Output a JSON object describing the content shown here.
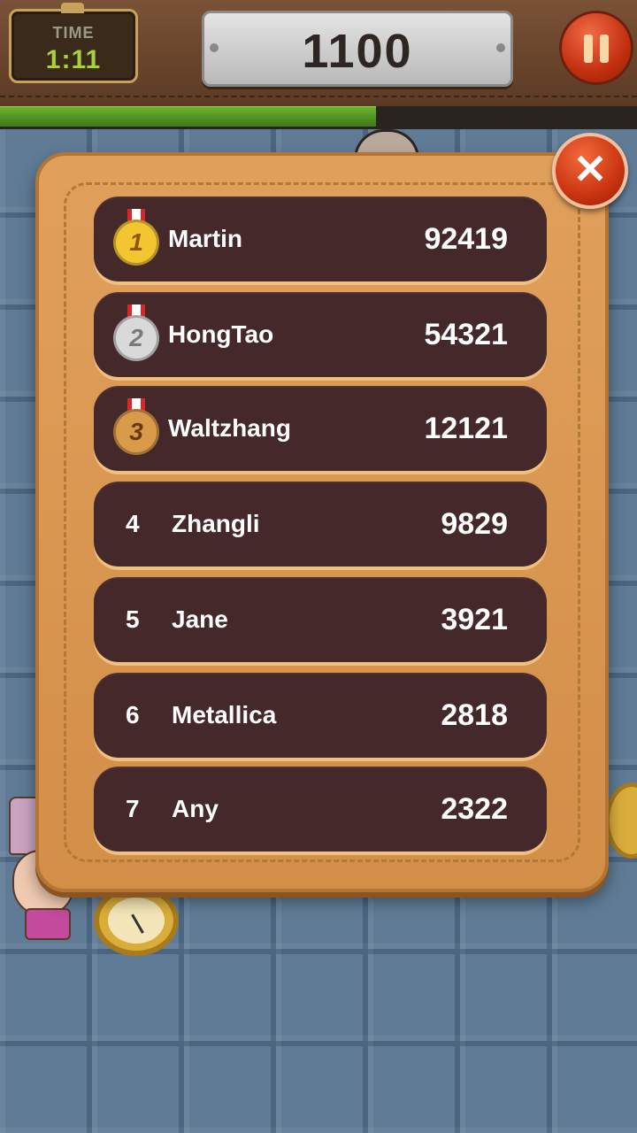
{
  "hud": {
    "time_label": "TIME",
    "time_value": "1:11",
    "score": "1100",
    "pause_icon": "pause-icon",
    "timer_progress": 0.59
  },
  "leaderboard": {
    "close_icon": "close-icon",
    "close_glyph": "✕",
    "entries": [
      {
        "rank": "1",
        "name": "Martin",
        "score": "92419",
        "medal": "gold"
      },
      {
        "rank": "2",
        "name": "HongTao",
        "score": "54321",
        "medal": "silver"
      },
      {
        "rank": "3",
        "name": "Waltzhang",
        "score": "12121",
        "medal": "bronze"
      },
      {
        "rank": "4",
        "name": "Zhangli",
        "score": "9829"
      },
      {
        "rank": "5",
        "name": "Jane",
        "score": "3921"
      },
      {
        "rank": "6",
        "name": "Metallica",
        "score": "2818"
      },
      {
        "rank": "7",
        "name": "Any",
        "score": "2322"
      }
    ]
  },
  "colors": {
    "gold": "#f2c531",
    "silver": "#d9d9d9",
    "bronze": "#d99a4a",
    "row_bg": "#45282a",
    "panel": "#dc9a54"
  }
}
